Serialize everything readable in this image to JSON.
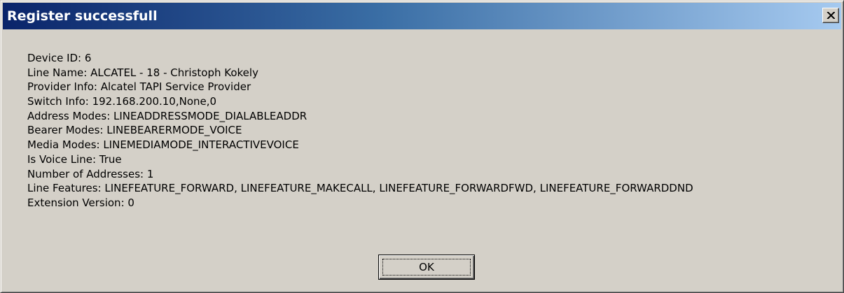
{
  "window": {
    "title": "Register successfull",
    "close_icon": "close-icon"
  },
  "info_lines": [
    "Device ID: 6",
    "Line Name: ALCATEL - 18 - Christoph Kokely",
    "Provider Info: Alcatel TAPI Service Provider",
    "Switch Info: 192.168.200.10,None,0",
    "Address Modes: LINEADDRESSMODE_DIALABLEADDR",
    "Bearer Modes: LINEBEARERMODE_VOICE",
    "Media Modes: LINEMEDIAMODE_INTERACTIVEVOICE",
    "Is Voice Line: True",
    "Number of Addresses: 1",
    "Line Features: LINEFEATURE_FORWARD, LINEFEATURE_MAKECALL, LINEFEATURE_FORWARDFWD, LINEFEATURE_FORWARDDND",
    "Extension Version: 0"
  ],
  "buttons": {
    "ok_label": "OK"
  },
  "colors": {
    "titlebar_start": "#0a246a",
    "titlebar_end": "#a6caf0",
    "dialog_face": "#d4d0c8"
  }
}
